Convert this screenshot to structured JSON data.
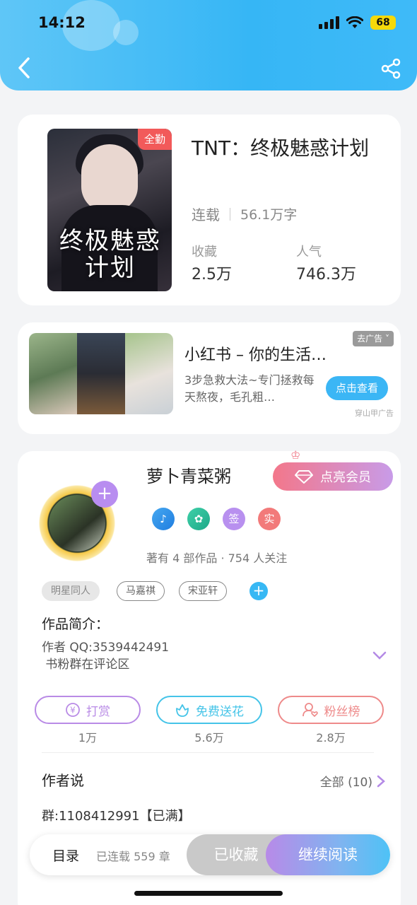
{
  "status_bar": {
    "time": "14:12",
    "battery": "68"
  },
  "header": {
    "back_icon": "chevron-left-icon",
    "share_icon": "share-icon"
  },
  "book": {
    "cover_badge": "全勤",
    "cover_title": "终极魅惑计划",
    "title": "TNT：终极魅惑计划",
    "status": "连载",
    "word_count": "56.1万字",
    "favorites_label": "收藏",
    "favorites_value": "2.5万",
    "popularity_label": "人气",
    "popularity_value": "746.3万"
  },
  "ad": {
    "tag": "去广告",
    "title": "小红书 – 你的生活…",
    "desc": "3步急救大法~专门拯救每天熬夜，毛孔粗…",
    "button": "点击查看",
    "source": "穿山甲广告"
  },
  "author": {
    "name": "萝卜青菜粥",
    "vip_button": "点亮会员",
    "honor_badges": [
      "签",
      "实"
    ],
    "works": "著有 4 部作品 · 754 人关注",
    "tags": [
      "明星同人",
      "马嘉祺",
      "宋亚轩"
    ],
    "intro_label": "作品简介：",
    "intro_text": "作者 QQ:3539442491\n 书粉群在评论区",
    "actions": [
      {
        "label": "打赏",
        "count": "1万",
        "color": "#b98be6"
      },
      {
        "label": "免费送花",
        "count": "5.6万",
        "color": "#45c4e8"
      },
      {
        "label": "粉丝榜",
        "count": "2.8万",
        "color": "#ee8a8a"
      }
    ],
    "says_label": "作者说",
    "says_all": "全部 (10)",
    "says_text": "群:1108412991【已满】"
  },
  "bottom_bar": {
    "toc": "目录",
    "chapters": "已连载 559 章",
    "favorited": "已收藏",
    "continue": "继续阅读"
  }
}
